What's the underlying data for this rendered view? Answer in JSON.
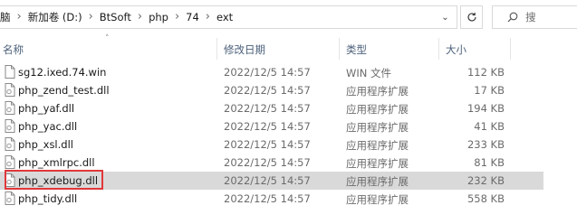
{
  "address_bar": {
    "crumbs": [
      "脑",
      "新加卷 (D:)",
      "BtSoft",
      "php",
      "74",
      "ext"
    ]
  },
  "search": {
    "placeholder": "搜"
  },
  "columns": {
    "name": "名称",
    "date": "修改日期",
    "type": "类型",
    "size": "大小"
  },
  "files": [
    {
      "name": "sg12.ixed.74.win",
      "date": "2022/12/5 14:57",
      "type": "WIN 文件",
      "size": "112 KB",
      "icon": "file-icon"
    },
    {
      "name": "php_zend_test.dll",
      "date": "2022/12/5 14:57",
      "type": "应用程序扩展",
      "size": "17 KB",
      "icon": "dll-file-icon"
    },
    {
      "name": "php_yaf.dll",
      "date": "2022/12/5 14:57",
      "type": "应用程序扩展",
      "size": "194 KB",
      "icon": "dll-file-icon"
    },
    {
      "name": "php_yac.dll",
      "date": "2022/12/5 14:57",
      "type": "应用程序扩展",
      "size": "41 KB",
      "icon": "dll-file-icon"
    },
    {
      "name": "php_xsl.dll",
      "date": "2022/12/5 14:57",
      "type": "应用程序扩展",
      "size": "233 KB",
      "icon": "dll-file-icon"
    },
    {
      "name": "php_xmlrpc.dll",
      "date": "2022/12/5 14:57",
      "type": "应用程序扩展",
      "size": "81 KB",
      "icon": "dll-file-icon"
    },
    {
      "name": "php_xdebug.dll",
      "date": "2022/12/5 14:57",
      "type": "应用程序扩展",
      "size": "232 KB",
      "icon": "dll-file-icon",
      "selected": true
    },
    {
      "name": "php_tidy.dll",
      "date": "2022/12/5 14:57",
      "type": "应用程序扩展",
      "size": "558 KB",
      "icon": "dll-file-icon"
    }
  ],
  "highlight_color": "#e0383b",
  "selection_color": "#d9d9d9"
}
